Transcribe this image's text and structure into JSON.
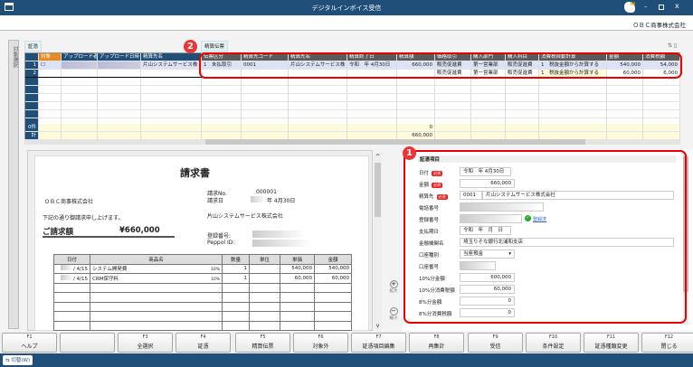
{
  "window": {
    "title": "デジタルインボイス受信",
    "company": "ＯＢＣ商事株式会社"
  },
  "sidetab": {
    "label": "対象選択"
  },
  "sections": {
    "voucher": "証憑",
    "settlement": "精算伝票"
  },
  "badges": {
    "one": "1",
    "two": "2"
  },
  "grid": {
    "columns": [
      "",
      "対象",
      "アップロード者名",
      "アップロード日時",
      "精算先名",
      "伝票区分",
      "精算先コード",
      "精算先名",
      "精算終了日",
      "精算額",
      "価格取引",
      "購入部門",
      "購入科目",
      "消費税自動計算",
      "金額",
      "消費税額"
    ],
    "rows": [
      [
        "1",
        "☐",
        "",
        "",
        "片山システムサービス株",
        "1　未払取引",
        "0001",
        "片山システムサービス株",
        "令和　年 4月30日",
        "660,000",
        "販売促進費",
        "第一営業部",
        "販売促進費",
        "1　税抜金額から計算する",
        "540,000",
        "54,000"
      ],
      [
        "2",
        "",
        "",
        "",
        "",
        "",
        "",
        "",
        "",
        "",
        "販売促進費",
        "第一営業部",
        "販売促進費",
        "1　税抜金額から計算する",
        "60,000",
        "6,000"
      ]
    ],
    "footer": [
      [
        "0件",
        "0"
      ],
      [
        "計",
        "660,000"
      ]
    ]
  },
  "invoice": {
    "title": "請求書",
    "to": "ＯＢＣ商事株式会社",
    "greeting": "下記の通り御請求申し上げます。",
    "amount_label": "ご請求額",
    "amount": "¥660,000",
    "no_label": "請求No.",
    "no": "000001",
    "date_label": "請求日",
    "date": "年 4月30日",
    "issuer": "片山システムサービス株式会社",
    "reg_label": "登録番号:",
    "peppol_label": "Peppol ID:",
    "headers": [
      "日付",
      "商品名",
      "数量",
      "単位",
      "単価",
      "金額"
    ],
    "lines": [
      [
        "/ 4/15",
        "システム開発費",
        "10%",
        "1",
        "",
        "540,000",
        "540,000"
      ],
      [
        "/ 4/15",
        "CRM保守料",
        "10%",
        "1",
        "",
        "60,000",
        "60,000"
      ]
    ]
  },
  "zoom": {
    "in": "拡大",
    "out": "縮小"
  },
  "fields": {
    "header": "証憑項目",
    "required": "必須",
    "date": {
      "label": "日付",
      "era": "令和",
      "value": "年 4月30日"
    },
    "amount": {
      "label": "金額",
      "value": "660,000"
    },
    "payee": {
      "label": "精算先",
      "code": "0001",
      "name": "片山システムサービス株式会社"
    },
    "phone": {
      "label": "電話番号"
    },
    "reg": {
      "label": "登録番号",
      "status": "登録済"
    },
    "paydate": {
      "label": "支払期日",
      "value": "令和　年　月　日"
    },
    "bank": {
      "label": "金融機関名",
      "value": "埼玉りそな銀行北浦和支店"
    },
    "acctype": {
      "label": "口座種別",
      "value": "当座預金"
    },
    "accno": {
      "label": "口座番号"
    },
    "amt10": {
      "label": "10%分金額",
      "value": "600,000"
    },
    "tax10": {
      "label": "10%分消費税額",
      "value": "60,000"
    },
    "amt8": {
      "label": "8%分金額",
      "value": "0"
    },
    "tax8": {
      "label": "8%分消費税額",
      "value": "0"
    }
  },
  "fkeys": [
    [
      "F1",
      "ヘルプ"
    ],
    [
      "",
      ""
    ],
    [
      "F3",
      "全選択"
    ],
    [
      "F4",
      "証憑"
    ],
    [
      "F5",
      "精算伝票"
    ],
    [
      "F6",
      "対象外"
    ],
    [
      "F7",
      "証憑項目編集"
    ],
    [
      "F8",
      "再集計"
    ],
    [
      "F9",
      "受信"
    ],
    [
      "F10",
      "条件設定"
    ],
    [
      "F11",
      "証憑種類変更"
    ],
    [
      "F12",
      "閉じる"
    ]
  ],
  "status": {
    "switch": "切替(W)"
  }
}
